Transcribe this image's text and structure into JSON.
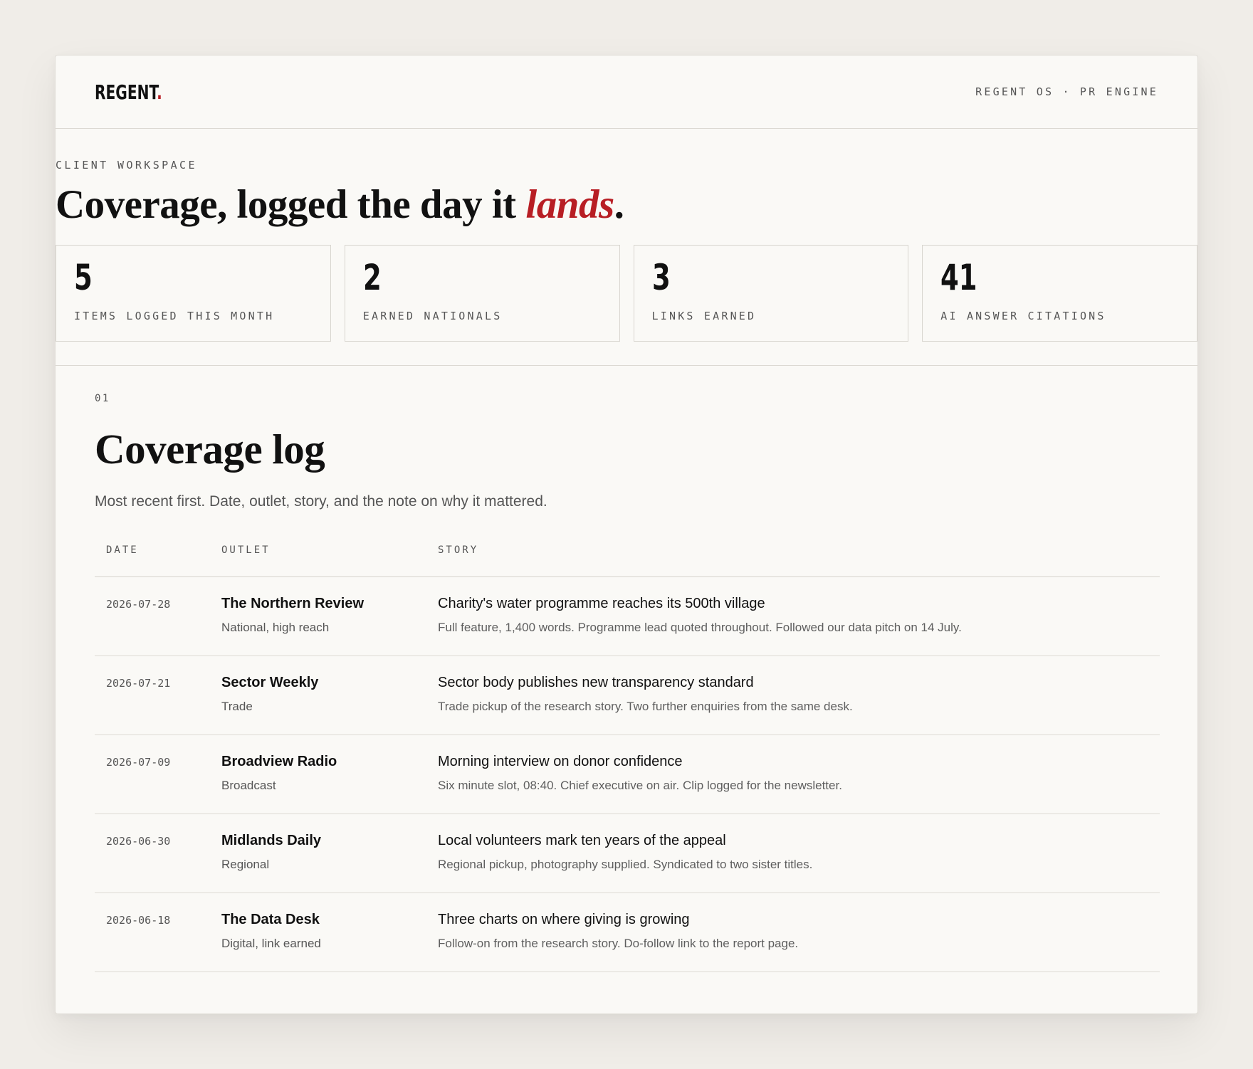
{
  "header": {
    "logo": "REGENT",
    "logo_dot": ".",
    "product": "REGENT OS · PR ENGINE"
  },
  "hero": {
    "eyebrow": "CLIENT WORKSPACE",
    "headline_prefix": "Coverage, logged the day it ",
    "headline_accent": "lands",
    "headline_suffix": "."
  },
  "stats": [
    {
      "value": "5",
      "label": "ITEMS LOGGED THIS MONTH"
    },
    {
      "value": "2",
      "label": "EARNED NATIONALS"
    },
    {
      "value": "3",
      "label": "LINKS EARNED"
    },
    {
      "value": "41",
      "label": "AI ANSWER CITATIONS"
    }
  ],
  "section": {
    "number": "01",
    "title": "Coverage log",
    "subtitle": "Most recent first. Date, outlet, story, and the note on why it mattered."
  },
  "table": {
    "headers": {
      "date": "DATE",
      "outlet": "OUTLET",
      "story": "STORY"
    },
    "rows": [
      {
        "date": "2026-07-28",
        "outlet": "The Northern Review",
        "outlet_type": "National, high reach",
        "story": "Charity's water programme reaches its 500th village",
        "note": "Full feature, 1,400 words. Programme lead quoted throughout. Followed our data pitch on 14 July."
      },
      {
        "date": "2026-07-21",
        "outlet": "Sector Weekly",
        "outlet_type": "Trade",
        "story": "Sector body publishes new transparency standard",
        "note": "Trade pickup of the research story. Two further enquiries from the same desk."
      },
      {
        "date": "2026-07-09",
        "outlet": "Broadview Radio",
        "outlet_type": "Broadcast",
        "story": "Morning interview on donor confidence",
        "note": "Six minute slot, 08:40. Chief executive on air. Clip logged for the newsletter."
      },
      {
        "date": "2026-06-30",
        "outlet": "Midlands Daily",
        "outlet_type": "Regional",
        "story": "Local volunteers mark ten years of the appeal",
        "note": "Regional pickup, photography supplied. Syndicated to two sister titles."
      },
      {
        "date": "2026-06-18",
        "outlet": "The Data Desk",
        "outlet_type": "Digital, link earned",
        "story": "Three charts on where giving is growing",
        "note": "Follow-on from the research story. Do-follow link to the report page."
      }
    ]
  },
  "colors": {
    "accent": "#b81e24",
    "background": "#f0ede8",
    "card": "#faf9f6"
  }
}
